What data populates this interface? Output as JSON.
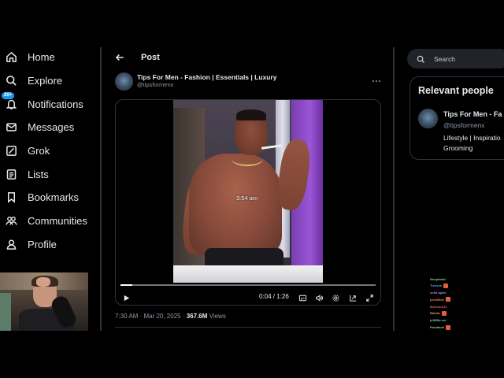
{
  "sidebar": {
    "items": [
      {
        "label": "Home",
        "icon": "home-icon"
      },
      {
        "label": "Explore",
        "icon": "search-icon"
      },
      {
        "label": "Notifications",
        "icon": "bell-icon",
        "badge": "20+"
      },
      {
        "label": "Messages",
        "icon": "envelope-icon"
      },
      {
        "label": "Grok",
        "icon": "grok-icon"
      },
      {
        "label": "Lists",
        "icon": "list-icon"
      },
      {
        "label": "Bookmarks",
        "icon": "bookmark-icon"
      },
      {
        "label": "Communities",
        "icon": "people-icon"
      },
      {
        "label": "Profile",
        "icon": "person-icon"
      }
    ]
  },
  "post": {
    "header_title": "Post",
    "author_name": "Tips For Men - Fashion | Essentials | Luxury",
    "author_handle": "@tipsformenx",
    "video": {
      "overlay_time": "3:54 am",
      "current": "0:04",
      "duration": "1:26",
      "time_readout": "0:04 / 1:26",
      "progress": 0.047
    },
    "timestamp": "7:30 AM · Mar 20, 2025 · ",
    "views_count": "367.6M",
    "views_label": " Views"
  },
  "right": {
    "search_placeholder": "Search",
    "relevant_title": "Relevant people",
    "person": {
      "name": "Tips For Men - Fa",
      "handle": "@tipsformenx",
      "bio_line1": "Lifestyle | Inspiratio",
      "bio_line2": "Grooming"
    }
  },
  "colors": {
    "background": "#000000",
    "text": "#e7e9ea",
    "muted": "#8b98a5",
    "accent": "#1d9bf0",
    "border": "#2f3336"
  },
  "chat": {
    "lines": [
      {
        "name": "Nooplastic",
        "color": "#7fd47f"
      },
      {
        "name": "Treesus",
        "color": "#5fa0ff"
      },
      {
        "name": "sofia agale",
        "color": "#b07fd4"
      },
      {
        "name": "pixelBlok",
        "color": "#e08040"
      },
      {
        "name": "Bellmont12",
        "color": "#d45f5f"
      },
      {
        "name": "Bianke",
        "color": "#d4a05f"
      },
      {
        "name": "jellBBa sol",
        "color": "#5fd4b0"
      },
      {
        "name": "Poodanel",
        "color": "#7fd47f"
      }
    ]
  }
}
